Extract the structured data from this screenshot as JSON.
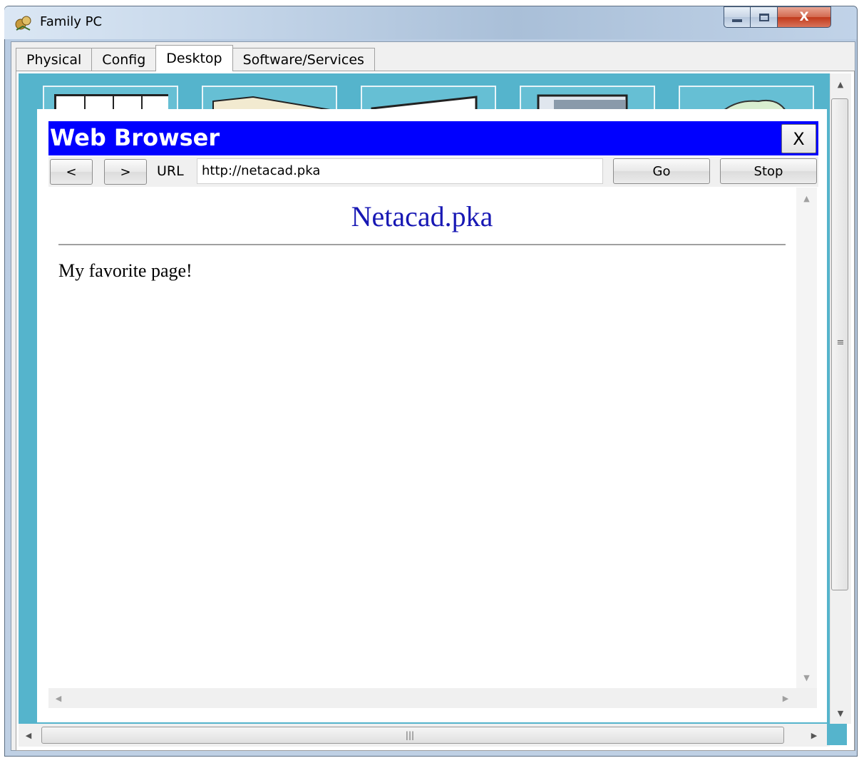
{
  "window": {
    "title": "Family PC",
    "close_glyph": "X"
  },
  "tabs": [
    "Physical",
    "Config",
    "Desktop",
    "Software/Services"
  ],
  "active_tab": "Desktop",
  "desktop_icons": [
    "physical-icon",
    "config-icon",
    "desktop-icon",
    "software-icon",
    "cloud-icon"
  ],
  "browser": {
    "title": "Web Browser",
    "close_label": "X",
    "back_label": "<",
    "forward_label": ">",
    "url_label": "URL",
    "url_value": "http://netacad.pka",
    "go_label": "Go",
    "stop_label": "Stop"
  },
  "page": {
    "heading": "Netacad.pka",
    "body_text": "My favorite page!"
  },
  "colors": {
    "browser_titlebar": "#0000ff",
    "desktop_background": "#55b4cc",
    "page_heading": "#1818b4"
  }
}
